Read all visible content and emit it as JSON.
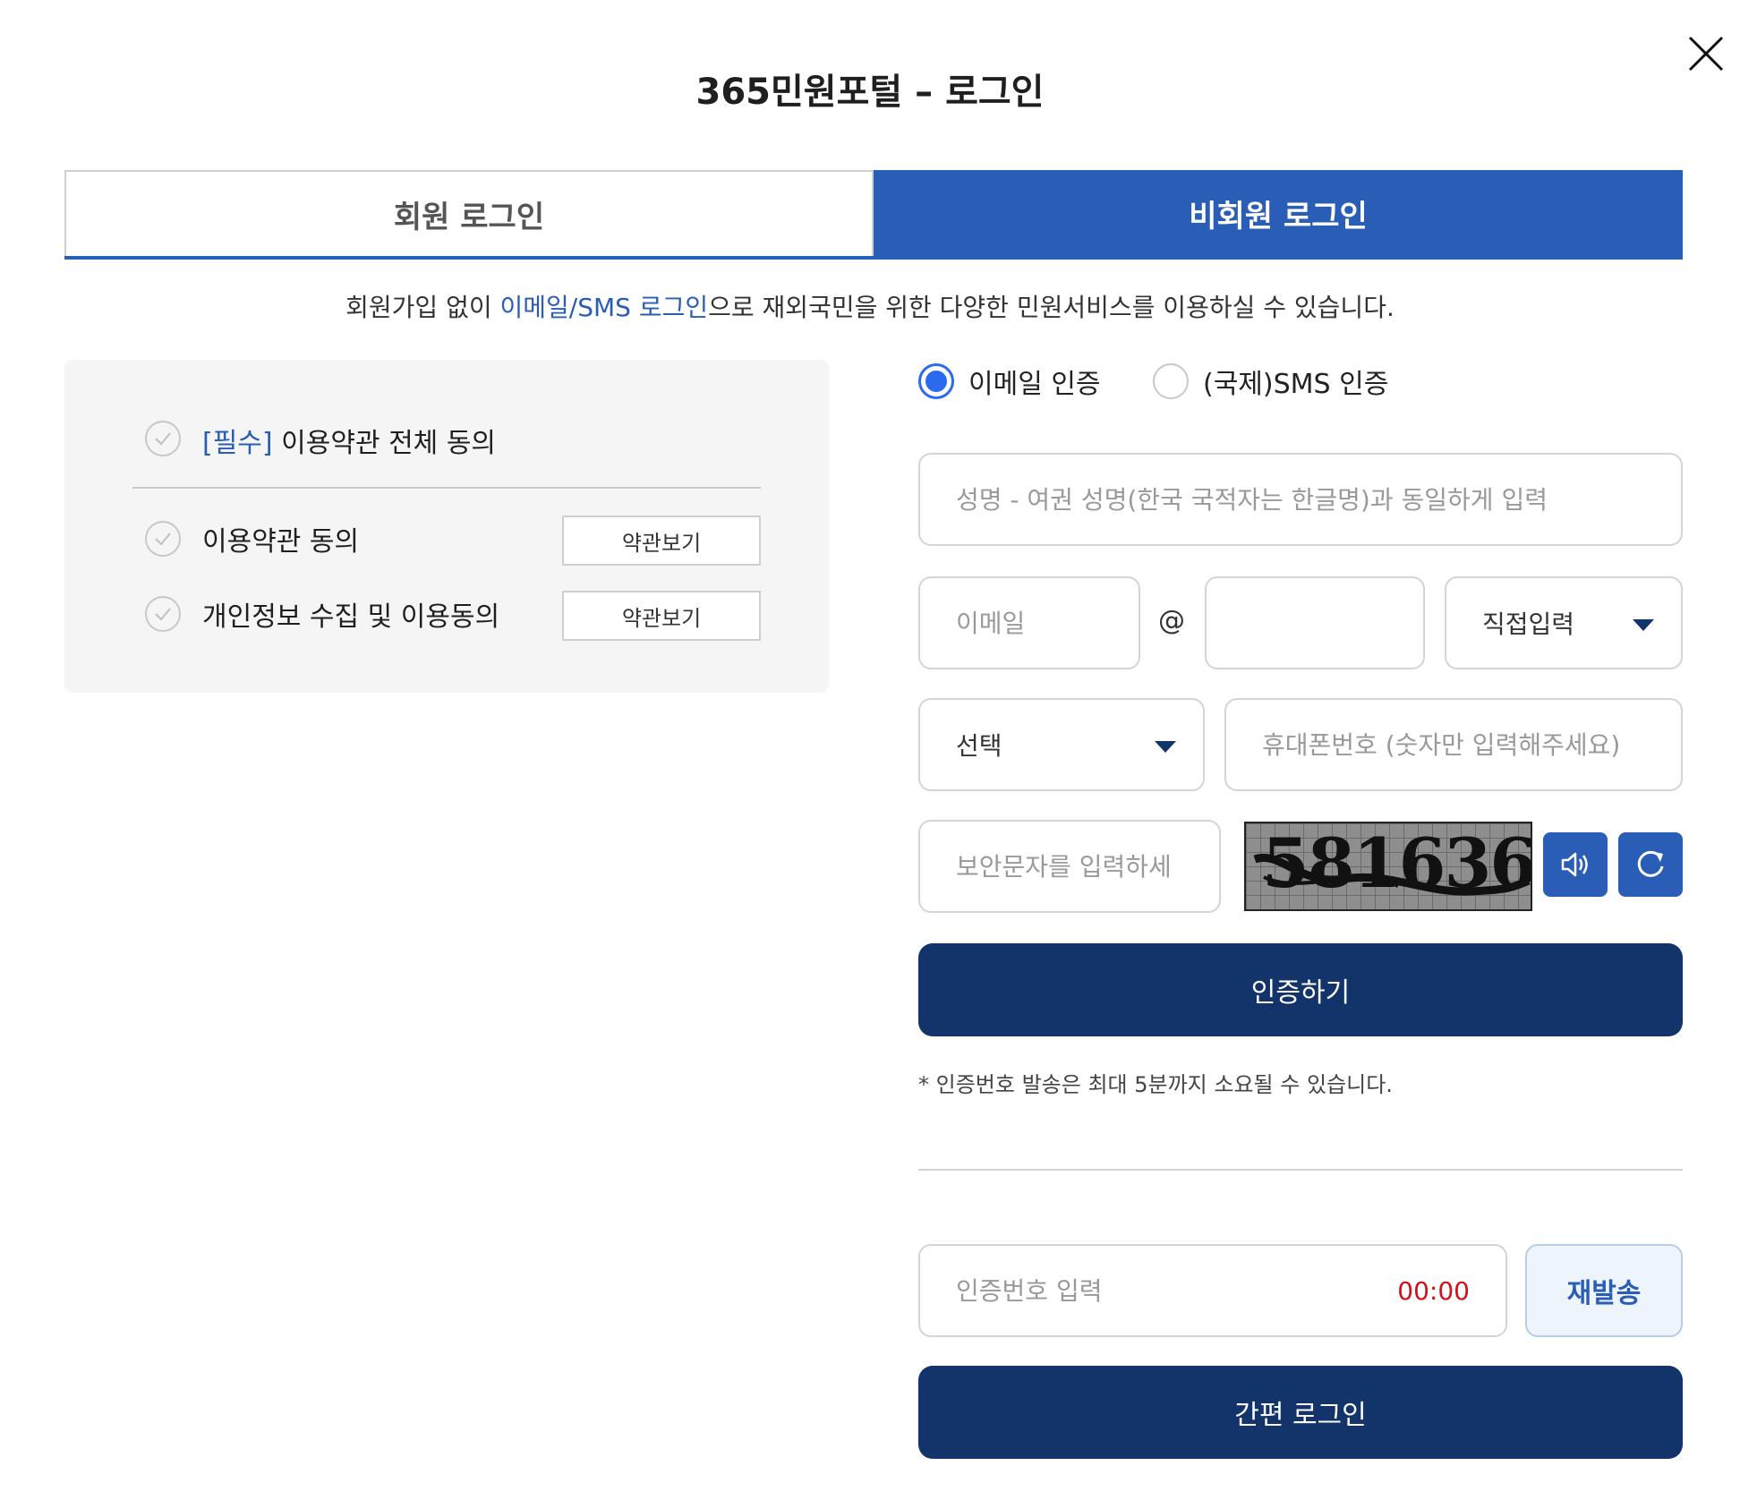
{
  "dialog": {
    "title": "365민원포털 – 로그인"
  },
  "tabs": {
    "member": "회원 로그인",
    "guest": "비회원 로그인"
  },
  "description": {
    "prefix": "회원가입 없이 ",
    "highlight": "이메일/SMS 로그인",
    "suffix": "으로 재외국민을 위한 다양한 민원서비스를 이용하실 수 있습니다."
  },
  "terms": {
    "all": {
      "required_tag": "[필수]",
      "label": " 이용약관 전체 동의"
    },
    "items": [
      {
        "label": "이용약관 동의",
        "view_button": "약관보기"
      },
      {
        "label": "개인정보 수집 및 이용동의",
        "view_button": "약관보기"
      }
    ]
  },
  "auth_method": {
    "options": [
      {
        "label": "이메일 인증",
        "selected": true
      },
      {
        "label": "(국제)SMS 인증",
        "selected": false
      }
    ]
  },
  "form": {
    "name_placeholder": "성명 - 여권 성명(한국 국적자는 한글명)과 동일하게 입력",
    "email_id_placeholder": "이메일",
    "email_at": "@",
    "email_domain_value": "",
    "email_domain_select": "직접입력",
    "country_code_select": "선택",
    "phone_placeholder": "휴대폰번호 (숫자만 입력해주세요)",
    "captcha_placeholder": "보안문자를 입력하세",
    "captcha_text": "581636",
    "verify_button": "인증하기",
    "notice": "* 인증번호 발송은 최대 5분까지 소요될 수 있습니다.",
    "code_placeholder": "인증번호 입력",
    "timer": "00:00",
    "resend_button": "재발송",
    "login_button": "간편 로그인"
  },
  "icons": {
    "close": "close-icon",
    "check": "check-icon",
    "audio": "speaker-icon",
    "refresh": "refresh-icon",
    "dropdown": "caret-down-icon"
  },
  "colors": {
    "primary_blue": "#2a5db6",
    "dark_navy": "#13346a",
    "radio_blue": "#2a6af0",
    "timer_red": "#d0121b",
    "panel_gray": "#f5f5f5"
  }
}
